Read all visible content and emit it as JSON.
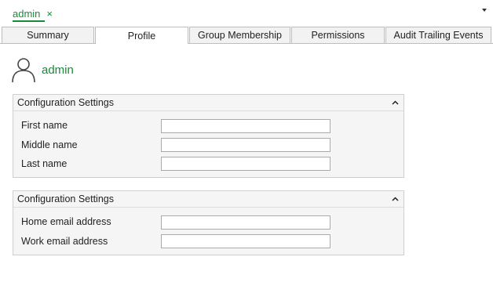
{
  "document_tab": {
    "title": "admin",
    "close_glyph": "×"
  },
  "page_tabs": [
    {
      "label": "Summary",
      "active": false
    },
    {
      "label": "Profile",
      "active": true
    },
    {
      "label": "Group Membership",
      "active": false
    },
    {
      "label": "Permissions",
      "active": false
    },
    {
      "label": "Audit Trailing Events",
      "active": false
    }
  ],
  "header": {
    "icon": "user-icon",
    "name": "admin"
  },
  "panels": [
    {
      "title": "Configuration Settings",
      "fields": [
        {
          "label": "First name",
          "value": ""
        },
        {
          "label": "Middle name",
          "value": ""
        },
        {
          "label": "Last name",
          "value": ""
        }
      ]
    },
    {
      "title": "Configuration Settings",
      "fields": [
        {
          "label": "Home email address",
          "value": ""
        },
        {
          "label": "Work email address",
          "value": ""
        }
      ]
    }
  ],
  "colors": {
    "accent": "#1a8a3a",
    "panel_bg": "#f5f5f5",
    "border": "#cfcfcf"
  }
}
